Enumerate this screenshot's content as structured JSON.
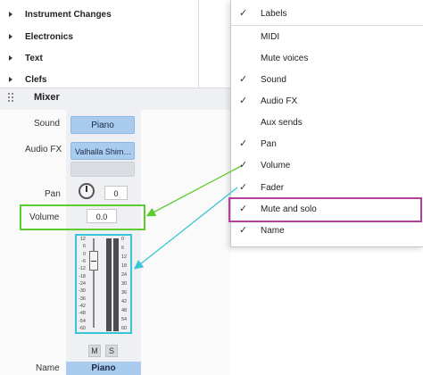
{
  "palette": {
    "items": [
      {
        "label": "Instrument Changes"
      },
      {
        "label": "Electronics"
      },
      {
        "label": "Text"
      },
      {
        "label": "Clefs"
      }
    ]
  },
  "mixer": {
    "title": "Mixer",
    "labels": {
      "sound": "Sound",
      "audio_fx": "Audio FX",
      "pan": "Pan",
      "volume": "Volume",
      "name": "Name"
    },
    "sound_value": "Piano",
    "audio_fx_value": "Valhalla Shim…",
    "pan_value": "0",
    "volume_value": "0.0",
    "mute_label": "M",
    "solo_label": "S",
    "channel_name": "Piano",
    "fader_scale_left": [
      "12",
      "6",
      "0",
      "-6",
      "-12",
      "-18",
      "-24",
      "-30",
      "-36",
      "-42",
      "-48",
      "-54",
      "-60"
    ],
    "fader_scale_right": [
      "0",
      "6",
      "12",
      "18",
      "24",
      "30",
      "36",
      "42",
      "48",
      "54",
      "60"
    ]
  },
  "menu": {
    "items": [
      {
        "label": "Labels",
        "checked": true
      },
      {
        "label": "MIDI",
        "checked": false
      },
      {
        "label": "Mute voices",
        "checked": false
      },
      {
        "label": "Sound",
        "checked": true
      },
      {
        "label": "Audio FX",
        "checked": true
      },
      {
        "label": "Aux sends",
        "checked": false
      },
      {
        "label": "Pan",
        "checked": true
      },
      {
        "label": "Volume",
        "checked": true
      },
      {
        "label": "Fader",
        "checked": true
      },
      {
        "label": "Mute and solo",
        "checked": true
      },
      {
        "label": "Name",
        "checked": true
      }
    ],
    "check_glyph": "✓"
  },
  "colors": {
    "accent_blue": "#a9cbee",
    "highlight_green": "#5ccc2d",
    "highlight_cyan": "#38c5d6",
    "highlight_magenta": "#b4409a"
  }
}
